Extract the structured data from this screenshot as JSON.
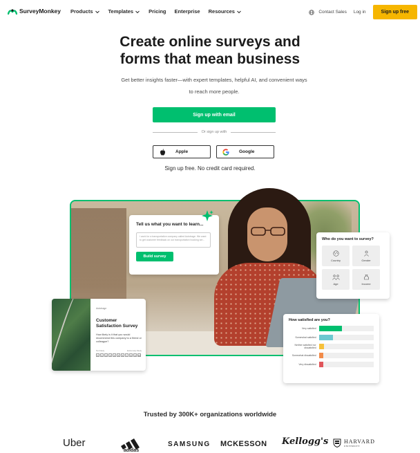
{
  "nav": {
    "brand": "SurveyMonkey",
    "links": [
      "Products",
      "Templates",
      "Pricing",
      "Enterprise",
      "Resources"
    ],
    "contact_sales": "Contact Sales",
    "log_in": "Log in",
    "sign_up": "Sign up free"
  },
  "hero": {
    "title_line1": "Create online surveys and",
    "title_line2": "forms that mean business",
    "subtitle_line1": "Get better insights faster—with expert templates, helpful AI, and convenient ways",
    "subtitle_line2": "to reach more people.",
    "cta": "Sign up with email",
    "or_text": "Or sign up with",
    "apple": "Apple",
    "google": "Google",
    "note": "Sign up free. No credit card required."
  },
  "cards": {
    "learn": {
      "title": "Tell us what you want to learn...",
      "placeholder": "I work for a transportation company called Autotrage. We want to get customer feedback on our transportation booking ser...",
      "button": "Build survey"
    },
    "who": {
      "title": "Who do you want to survey?",
      "options": [
        "Country",
        "Gender",
        "Age",
        "Income"
      ]
    },
    "survey": {
      "brand": "Autotrage",
      "title": "Customer Satisfaction Survey",
      "question": "How likely is it that you would recommend this company to a friend or colleague?",
      "low_label": "Not likely",
      "high_label": "Extremely likely",
      "scale": [
        "0",
        "1",
        "2",
        "3",
        "4",
        "5",
        "6",
        "7",
        "8",
        "9",
        "10"
      ]
    },
    "satisfaction": {
      "title": "How satisfied are you?",
      "rows": [
        {
          "label": "Very satisfied",
          "value": 0.42,
          "color": "#00bf6f"
        },
        {
          "label": "Somewhat satisfied",
          "value": 0.25,
          "color": "#6bc8d0"
        },
        {
          "label": "Neither satisfied nor dissatisfied",
          "value": 0.09,
          "color": "#f6c13b"
        },
        {
          "label": "Somewhat dissatisfied",
          "value": 0.08,
          "color": "#f28c4a"
        },
        {
          "label": "Very dissatisfied",
          "value": 0.08,
          "color": "#e0565b"
        }
      ]
    }
  },
  "trusted": {
    "heading": "Trusted by 300K+ organizations worldwide",
    "logos": {
      "uber": "Uber",
      "adidas": "adidas",
      "samsung": "SAMSUNG",
      "mckesson": "MCKESSON",
      "kelloggs": "Kellogg's",
      "harvard": "HARVARD",
      "harvard_sub": "UNIVERSITY"
    }
  }
}
